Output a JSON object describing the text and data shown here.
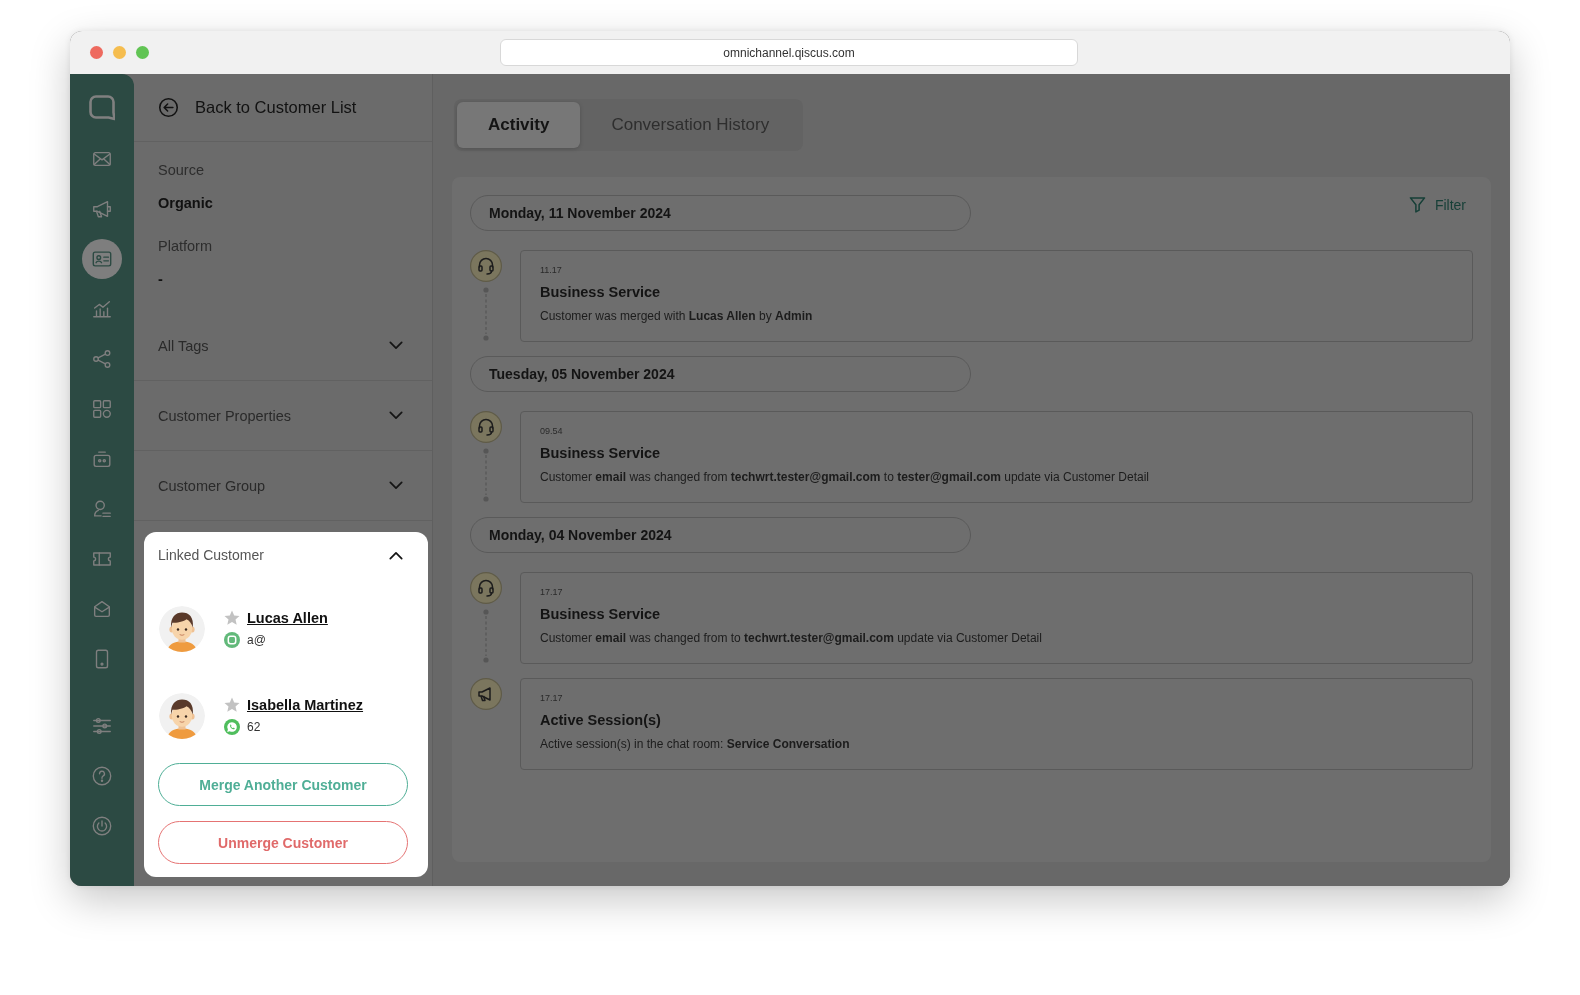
{
  "browser": {
    "url": "omnichannel.qiscus.com"
  },
  "sidebar": {
    "items": [
      {
        "selected": false
      },
      {
        "selected": false
      },
      {
        "selected": true
      },
      {
        "selected": false
      },
      {
        "selected": false
      },
      {
        "selected": false
      },
      {
        "selected": false
      },
      {
        "selected": false
      },
      {
        "selected": false
      },
      {
        "selected": false
      },
      {
        "selected": false
      }
    ],
    "footer_items": [
      {
        "selected": false
      },
      {
        "selected": false
      },
      {
        "selected": false
      }
    ]
  },
  "customer_panel": {
    "back_link": "Back to Customer List",
    "fields": [
      {
        "label": "Source",
        "value": "Organic"
      },
      {
        "label": "Platform",
        "value": "-"
      }
    ],
    "sections": [
      {
        "title": "All Tags",
        "expanded": false
      },
      {
        "title": "Customer Properties",
        "expanded": false
      },
      {
        "title": "Customer Group",
        "expanded": false
      }
    ],
    "linked_customer": {
      "title": "Linked Customer",
      "expanded": true,
      "customers": [
        {
          "name": "Lucas Allen",
          "starred": false,
          "kind": "chat",
          "contact": "a@"
        },
        {
          "name": "Isabella Martinez",
          "starred": false,
          "kind": "phone",
          "contact": "62"
        }
      ],
      "buttons": [
        {
          "label": "Merge Another Customer",
          "kind": "primary"
        },
        {
          "label": "Unmerge Customer",
          "kind": "danger"
        }
      ]
    }
  },
  "activity": {
    "tabs": [
      {
        "label": "Activity",
        "selected": true
      },
      {
        "label": "Conversation History",
        "selected": false
      }
    ],
    "filter": "Filter",
    "timeline": [
      {
        "date": "Monday, 11 November 2024",
        "events": [
          {
            "kind": "service",
            "time": "11.17",
            "title": "Business Service",
            "text": "Customer was merged with **Lucas Allen** by **Admin**"
          }
        ]
      },
      {
        "date": "Tuesday, 05 November 2024",
        "events": [
          {
            "kind": "service",
            "time": "09.54",
            "title": "Business Service",
            "text": "Customer **email** was changed from **techwrt.tester@gmail.com** to **tester@gmail.com** update via Customer Detail"
          }
        ]
      },
      {
        "date": "Monday, 04 November 2024",
        "events": [
          {
            "kind": "service",
            "time": "17.17",
            "title": "Business Service",
            "text": "Customer **email** was changed from to **techwrt.tester@gmail.com** update via Customer Detail"
          },
          {
            "kind": "session",
            "time": "17.17",
            "title": "Active Session(s)",
            "text": "Active session(s) in the chat room: **Service Conversation**"
          }
        ]
      }
    ]
  }
}
